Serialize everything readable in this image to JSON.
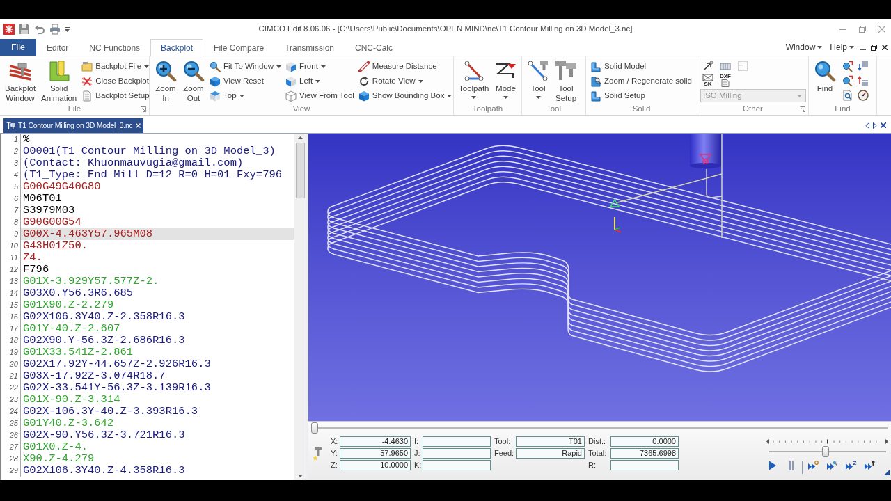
{
  "title_bar": {
    "title": "CIMCO Edit 8.06.06 - [C:\\Users\\Public\\Documents\\OPEN MIND\\nc\\T1 Contour Milling on 3D Model_3.nc]"
  },
  "file_button": {
    "label": "File"
  },
  "ribbon_tabs": [
    {
      "label": "Editor",
      "selected": false
    },
    {
      "label": "NC Functions",
      "selected": false
    },
    {
      "label": "Backplot",
      "selected": true
    },
    {
      "label": "File Compare",
      "selected": false
    },
    {
      "label": "Transmission",
      "selected": false
    },
    {
      "label": "CNC-Calc",
      "selected": false
    }
  ],
  "menu_right": [
    {
      "label": "Window"
    },
    {
      "label": "Help"
    }
  ],
  "ribbon_groups": [
    {
      "label": "File",
      "launcher": true,
      "items": [
        {
          "kind": "large",
          "label": "Backplot Window",
          "dropdown": false
        },
        {
          "kind": "large",
          "label": "Solid Animation",
          "dropdown": false
        },
        {
          "kind": "column",
          "buttons": [
            {
              "label": "Backplot File",
              "dropdown": true
            },
            {
              "label": "Close Backplot",
              "dropdown": false
            },
            {
              "label": "Backplot Setup",
              "dropdown": false
            }
          ]
        }
      ]
    },
    {
      "label": "View",
      "launcher": false,
      "items": [
        {
          "kind": "large",
          "label": "Zoom In",
          "dropdown": false
        },
        {
          "kind": "large",
          "label": "Zoom Out",
          "dropdown": false
        },
        {
          "kind": "column",
          "buttons": [
            {
              "label": "Fit To Window",
              "dropdown": true
            },
            {
              "label": "View Reset",
              "dropdown": false
            },
            {
              "label": "Top",
              "dropdown": true
            }
          ]
        },
        {
          "kind": "column",
          "buttons": [
            {
              "label": "Front",
              "dropdown": true
            },
            {
              "label": "Left",
              "dropdown": true
            },
            {
              "label": "View From Tool",
              "dropdown": false
            }
          ]
        },
        {
          "kind": "column",
          "buttons": [
            {
              "label": "Measure Distance",
              "dropdown": false
            },
            {
              "label": "Rotate View",
              "dropdown": true
            },
            {
              "label": "Show Bounding Box",
              "dropdown": true
            }
          ]
        }
      ]
    },
    {
      "label": "Toolpath",
      "launcher": false,
      "items": [
        {
          "kind": "large",
          "label": "Toolpath",
          "dropdown": true
        },
        {
          "kind": "large",
          "label": "Mode",
          "dropdown": true
        }
      ]
    },
    {
      "label": "Tool",
      "launcher": false,
      "items": [
        {
          "kind": "large",
          "label": "Tool",
          "dropdown": true
        },
        {
          "kind": "large",
          "label": "Tool Setup",
          "dropdown": false
        }
      ]
    },
    {
      "label": "Solid",
      "launcher": false,
      "items": [
        {
          "kind": "column",
          "buttons": [
            {
              "label": "Solid Model",
              "dropdown": false
            },
            {
              "label": "Zoom / Regenerate solid",
              "dropdown": false
            },
            {
              "label": "Solid Setup",
              "dropdown": false
            }
          ]
        }
      ]
    },
    {
      "label": "Other",
      "launcher": true,
      "items": [
        {
          "kind": "icon_rows",
          "rows": [
            [
              {
                "disabled": false
              },
              {
                "disabled": false
              },
              {
                "disabled": true
              }
            ],
            [
              {
                "disabled": false,
                "label": "SK"
              },
              {
                "disabled": false,
                "label": "DXF"
              }
            ]
          ]
        },
        {
          "kind": "combo",
          "value": "ISO Milling",
          "disabled": true
        }
      ]
    },
    {
      "label": "Find",
      "launcher": false,
      "items": [
        {
          "kind": "large",
          "label": "Find",
          "dropdown": false
        },
        {
          "kind": "icon_rows",
          "rows": [
            [
              {
                "disabled": false
              },
              {
                "disabled": false
              }
            ],
            [
              {
                "disabled": false
              },
              {
                "disabled": false
              }
            ],
            [
              {
                "disabled": false
              },
              {
                "disabled": false
              }
            ]
          ]
        }
      ]
    }
  ],
  "document_tabs": [
    {
      "label": "T1 Contour Milling on 3D Model_3.nc",
      "selected": true
    }
  ],
  "editor": {
    "lines": [
      {
        "number": "1",
        "code": "%",
        "color": "#000000",
        "selected": false
      },
      {
        "number": "2",
        "code": "O0001(T1 Contour Milling on 3D Model_3)",
        "color": "#1a1a80",
        "selected": false
      },
      {
        "number": "3",
        "code": "(Contact: Khuonmauvugia@gmail.com)",
        "color": "#1a1a80",
        "selected": false
      },
      {
        "number": "4",
        "code": "(T1_Type: End Mill D=12 R=0 H=01 Fxy=796",
        "color": "#1a1a80",
        "selected": false
      },
      {
        "number": "5",
        "code": "G00G49G40G80",
        "color": "#a82020",
        "selected": false
      },
      {
        "number": "6",
        "code": "M06T01",
        "color": "#000000",
        "selected": false
      },
      {
        "number": "7",
        "code": "S3979M03",
        "color": "#000000",
        "selected": false
      },
      {
        "number": "8",
        "code": "G90G00G54",
        "color": "#a82020",
        "selected": false
      },
      {
        "number": "9",
        "code": "G00X-4.463Y57.965M08",
        "color": "#a82020",
        "selected": true
      },
      {
        "number": "10",
        "code": "G43H01Z50.",
        "color": "#a82020",
        "selected": false
      },
      {
        "number": "11",
        "code": "Z4.",
        "color": "#a82020",
        "selected": false
      },
      {
        "number": "12",
        "code": "F796",
        "color": "#000000",
        "selected": false
      },
      {
        "number": "13",
        "code": "G01X-3.929Y57.577Z-2.",
        "color": "#2fa52f",
        "selected": false
      },
      {
        "number": "14",
        "code": "G03X0.Y56.3R6.685",
        "color": "#1a1a80",
        "selected": false
      },
      {
        "number": "15",
        "code": "G01X90.Z-2.279",
        "color": "#2fa52f",
        "selected": false
      },
      {
        "number": "16",
        "code": "G02X106.3Y40.Z-2.358R16.3",
        "color": "#1a1a80",
        "selected": false
      },
      {
        "number": "17",
        "code": "G01Y-40.Z-2.607",
        "color": "#2fa52f",
        "selected": false
      },
      {
        "number": "18",
        "code": "G02X90.Y-56.3Z-2.686R16.3",
        "color": "#1a1a80",
        "selected": false
      },
      {
        "number": "19",
        "code": "G01X33.541Z-2.861",
        "color": "#2fa52f",
        "selected": false
      },
      {
        "number": "20",
        "code": "G02X17.92Y-44.657Z-2.926R16.3",
        "color": "#1a1a80",
        "selected": false
      },
      {
        "number": "21",
        "code": "G03X-17.92Z-3.074R18.7",
        "color": "#1a1a80",
        "selected": false
      },
      {
        "number": "22",
        "code": "G02X-33.541Y-56.3Z-3.139R16.3",
        "color": "#1a1a80",
        "selected": false
      },
      {
        "number": "23",
        "code": "G01X-90.Z-3.314",
        "color": "#2fa52f",
        "selected": false
      },
      {
        "number": "24",
        "code": "G02X-106.3Y-40.Z-3.393R16.3",
        "color": "#1a1a80",
        "selected": false
      },
      {
        "number": "25",
        "code": "G01Y40.Z-3.642",
        "color": "#2fa52f",
        "selected": false
      },
      {
        "number": "26",
        "code": "G02X-90.Y56.3Z-3.721R16.3",
        "color": "#1a1a80",
        "selected": false
      },
      {
        "number": "27",
        "code": "G01X0.Z-4.",
        "color": "#2fa52f",
        "selected": false
      },
      {
        "number": "28",
        "code": "X90.Z-4.279",
        "color": "#2fa52f",
        "selected": false
      },
      {
        "number": "29",
        "code": "G02X106.3Y40.Z-4.358R16.3",
        "color": "#1a1a80",
        "selected": false
      }
    ]
  },
  "status_panel": {
    "position_slider": {
      "level": 0
    },
    "field_groups": [
      [
        {
          "label": "X:",
          "value": "-4.4630"
        },
        {
          "label": "Y:",
          "value": "57.9650"
        },
        {
          "label": "Z:",
          "value": "10.0000"
        }
      ],
      [
        {
          "label": "I:"
        },
        {
          "label": "J:"
        },
        {
          "label": "K:"
        }
      ],
      [
        {
          "label": "Tool:",
          "value": "T01"
        },
        {
          "label": "Feed:",
          "value": "Rapid"
        }
      ],
      [
        {
          "label": "Dist.:",
          "value": "0.0000"
        },
        {
          "label": "Total:",
          "value": "7365.6998"
        },
        {
          "label": "R:"
        }
      ]
    ],
    "speed_slider": {
      "level": 0.49
    },
    "playback": [
      {
        "kind": "play"
      },
      {
        "kind": "pause"
      },
      {
        "kind": "step_point"
      },
      {
        "kind": "step_search"
      },
      {
        "kind": "step_z",
        "label": "Z"
      },
      {
        "kind": "step_tool"
      }
    ]
  }
}
